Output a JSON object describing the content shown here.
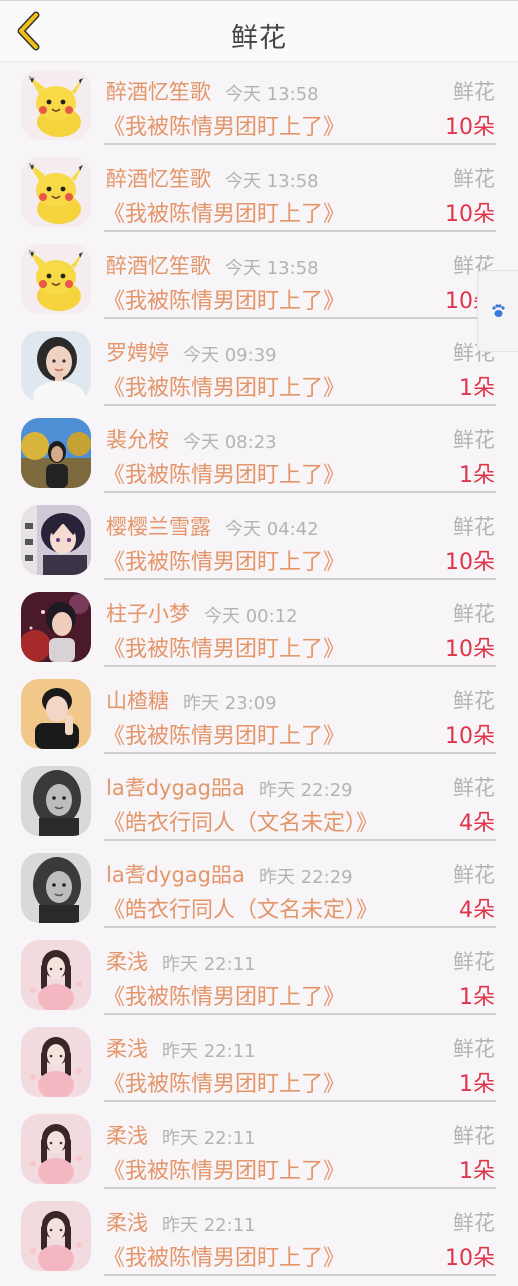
{
  "header": {
    "title": "鲜花"
  },
  "icons": {
    "back": "chevron-left-icon",
    "float_tab": "paw-icon"
  },
  "colors": {
    "accent_name": "#e4956a",
    "count_red": "#e0344a",
    "meta_gray": "#b4b4b4",
    "back_arrow": "#f0c018"
  },
  "gifts": [
    {
      "name": "醉酒忆笙歌",
      "time": "今天 13:58",
      "type": "鲜花",
      "book": "《我被陈情男团盯上了》",
      "count": "10朵",
      "avatar": "pikachu"
    },
    {
      "name": "醉酒忆笙歌",
      "time": "今天 13:58",
      "type": "鲜花",
      "book": "《我被陈情男团盯上了》",
      "count": "10朵",
      "avatar": "pikachu"
    },
    {
      "name": "醉酒忆笙歌",
      "time": "今天 13:58",
      "type": "鲜花",
      "book": "《我被陈情男团盯上了》",
      "count": "10朵",
      "avatar": "pikachu"
    },
    {
      "name": "罗娉婷",
      "time": "今天 09:39",
      "type": "鲜花",
      "book": "《我被陈情男团盯上了》",
      "count": "1朵",
      "avatar": "woman-white"
    },
    {
      "name": "裴允桉",
      "time": "今天 08:23",
      "type": "鲜花",
      "book": "《我被陈情男团盯上了》",
      "count": "1朵",
      "avatar": "outdoor"
    },
    {
      "name": "樱樱兰雪露",
      "time": "今天 04:42",
      "type": "鲜花",
      "book": "《我被陈情男团盯上了》",
      "count": "10朵",
      "avatar": "anime"
    },
    {
      "name": "柱子小梦",
      "time": "今天 00:12",
      "type": "鲜花",
      "book": "《我被陈情男团盯上了》",
      "count": "10朵",
      "avatar": "fantasy"
    },
    {
      "name": "山楂糖",
      "time": "昨天 23:09",
      "type": "鲜花",
      "book": "《我被陈情男团盯上了》",
      "count": "10朵",
      "avatar": "man-dark"
    },
    {
      "name": "la㖈dygag㗊a",
      "time": "昨天 22:29",
      "type": "鲜花",
      "book": "《皓衣行同人（文名未定）》",
      "count": "4朵",
      "avatar": "bw-girl"
    },
    {
      "name": "la㖈dygag㗊a",
      "time": "昨天 22:29",
      "type": "鲜花",
      "book": "《皓衣行同人（文名未定）》",
      "count": "4朵",
      "avatar": "bw-girl"
    },
    {
      "name": "柔浅",
      "time": "昨天 22:11",
      "type": "鲜花",
      "book": "《我被陈情男团盯上了》",
      "count": "1朵",
      "avatar": "pink-girl"
    },
    {
      "name": "柔浅",
      "time": "昨天 22:11",
      "type": "鲜花",
      "book": "《我被陈情男团盯上了》",
      "count": "1朵",
      "avatar": "pink-girl"
    },
    {
      "name": "柔浅",
      "time": "昨天 22:11",
      "type": "鲜花",
      "book": "《我被陈情男团盯上了》",
      "count": "1朵",
      "avatar": "pink-girl"
    },
    {
      "name": "柔浅",
      "time": "昨天 22:11",
      "type": "鲜花",
      "book": "《我被陈情男团盯上了》",
      "count": "10朵",
      "avatar": "pink-girl"
    }
  ]
}
